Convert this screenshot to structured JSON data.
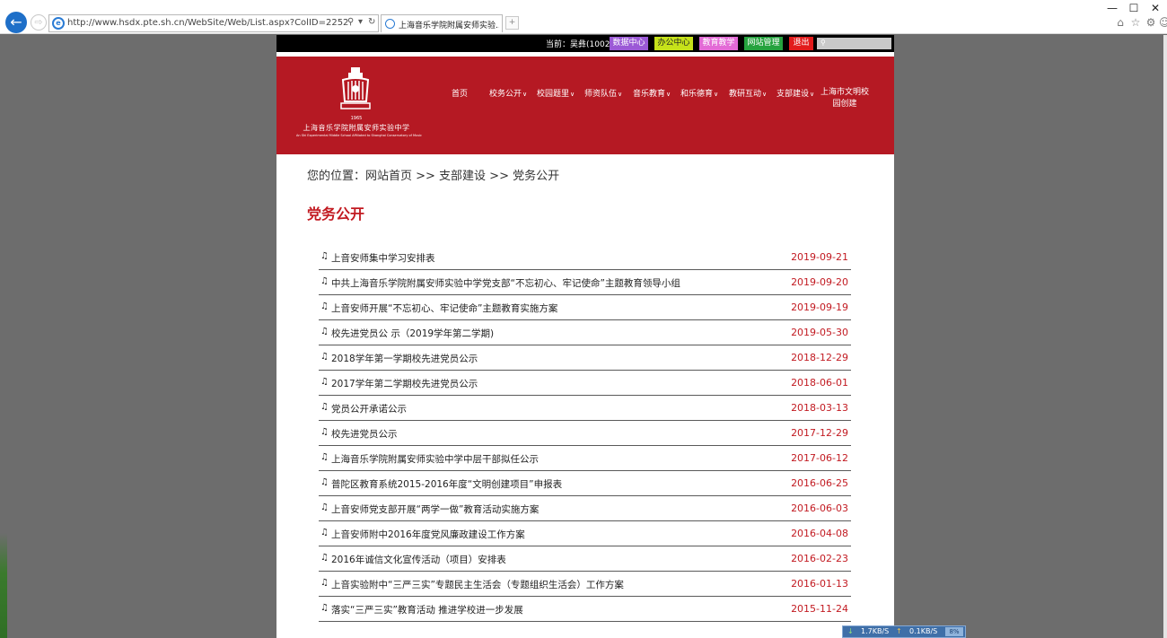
{
  "browser": {
    "url": "http://www.hsdx.pte.sh.cn/WebSite/Web/List.aspx?ColID=2252",
    "tab_title": "上海音乐学院附属安师实验...",
    "search_glyph": "⚲",
    "refresh_glyph": "↻",
    "dropdown_glyph": "▾",
    "back_glyph": "←",
    "forward_glyph": "⇨",
    "min_glyph": "—",
    "max_glyph": "☐",
    "close_glyph": "✕",
    "home_glyph": "⌂",
    "star_glyph": "☆",
    "gear_glyph": "⚙",
    "smile_glyph": "☺"
  },
  "topbar": {
    "current_user": "当前：吴彝(1002)",
    "buttons": [
      {
        "label": "数据中心",
        "color": "#9b59d6"
      },
      {
        "label": "办公中心",
        "color": "#c6e21a"
      },
      {
        "label": "教育教学",
        "color": "#e36ad6"
      },
      {
        "label": "网站管理",
        "color": "#25a23e"
      },
      {
        "label": "退出",
        "color": "#e21b1b"
      }
    ]
  },
  "school": {
    "year": "1965",
    "name_cn": "上海音乐学院附属安师实验中学",
    "name_en": "An Shi Experimental Middle School Affiliated to Shanghai Conservatory of Music"
  },
  "nav": {
    "items": [
      "首页",
      "校务公开",
      "校园题里",
      "师资队伍",
      "音乐教育",
      "和乐德育",
      "教研互动",
      "支部建设"
    ],
    "last_line1": "上海市文明校",
    "last_line2": "园创建",
    "chevron": "∨"
  },
  "breadcrumb": "您的位置：网站首页 >> 支部建设 >> 党务公开",
  "page_title": "党务公开",
  "list_bullet": "♫",
  "articles": [
    {
      "title": "上音安师集中学习安排表",
      "date": "2019-09-21"
    },
    {
      "title": "中共上海音乐学院附属安师实验中学党支部“不忘初心、牢记使命”主题教育领导小组",
      "date": "2019-09-20"
    },
    {
      "title": "上音安师开展“不忘初心、牢记使命”主题教育实施方案",
      "date": "2019-09-19"
    },
    {
      "title": "校先进党员公 示（2019学年第二学期)",
      "date": "2019-05-30"
    },
    {
      "title": "2018学年第一学期校先进党员公示",
      "date": "2018-12-29"
    },
    {
      "title": "2017学年第二学期校先进党员公示",
      "date": "2018-06-01"
    },
    {
      "title": "党员公开承诺公示",
      "date": "2018-03-13"
    },
    {
      "title": "校先进党员公示",
      "date": "2017-12-29"
    },
    {
      "title": "上海音乐学院附属安师实验中学中层干部拟任公示",
      "date": "2017-06-12"
    },
    {
      "title": "普陀区教育系统2015-2016年度“文明创建项目”申报表",
      "date": "2016-06-25"
    },
    {
      "title": "上音安师党支部开展“两学一做”教育活动实施方案",
      "date": "2016-06-03"
    },
    {
      "title": "上音安师附中2016年度党风廉政建设工作方案",
      "date": "2016-04-08"
    },
    {
      "title": "2016年诚信文化宣传活动（项目）安排表",
      "date": "2016-02-23"
    },
    {
      "title": "上音实验附中“三严三实”专题民主生活会（专题组织生活会）工作方案",
      "date": "2016-01-13"
    },
    {
      "title": "落实“三严三实”教育活动 推进学校进一步发展",
      "date": "2015-11-24"
    }
  ],
  "netmeter": {
    "down": "1.7KB/S",
    "up": "0.1KB/S",
    "percent": "8%"
  }
}
